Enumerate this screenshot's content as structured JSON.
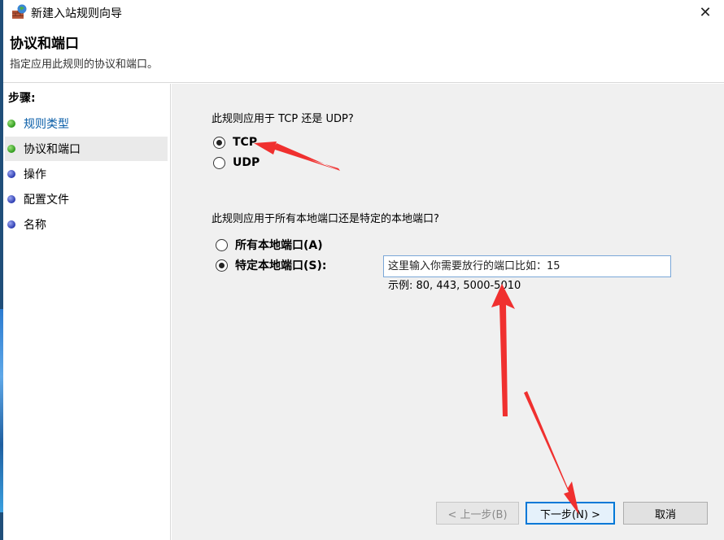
{
  "window": {
    "title": "新建入站规则向导",
    "close_glyph": "✕"
  },
  "header": {
    "title": "协议和端口",
    "subtitle": "指定应用此规则的协议和端口。"
  },
  "sidebar": {
    "heading": "步骤:",
    "items": [
      {
        "label": "规则类型",
        "status": "completed"
      },
      {
        "label": "协议和端口",
        "status": "current"
      },
      {
        "label": "操作",
        "status": "pending"
      },
      {
        "label": "配置文件",
        "status": "pending"
      },
      {
        "label": "名称",
        "status": "pending"
      }
    ]
  },
  "protocol": {
    "question": "此规则应用于 TCP 还是 UDP?",
    "options": [
      {
        "label": "TCP",
        "selected": true
      },
      {
        "label": "UDP",
        "selected": false
      }
    ]
  },
  "ports": {
    "question": "此规则应用于所有本地端口还是特定的本地端口?",
    "options": [
      {
        "label": "所有本地端口(A)",
        "selected": false
      },
      {
        "label": "特定本地端口(S):",
        "selected": true
      }
    ],
    "input_value": "这里输入你需要放行的端口比如：15",
    "example": "示例: 80, 443, 5000-5010"
  },
  "buttons": {
    "back": "< 上一步(B)",
    "next": "下一步(N) >",
    "cancel": "取消"
  },
  "colors": {
    "accent_blue": "#0078d7",
    "link_blue": "#0a5ea8",
    "annotation_red": "#f0302f",
    "pane_gray": "#f0f0f0"
  },
  "icons": {
    "app": "firewall-icon",
    "completed_step": "green-dot-icon",
    "pending_step": "blue-dot-icon"
  }
}
